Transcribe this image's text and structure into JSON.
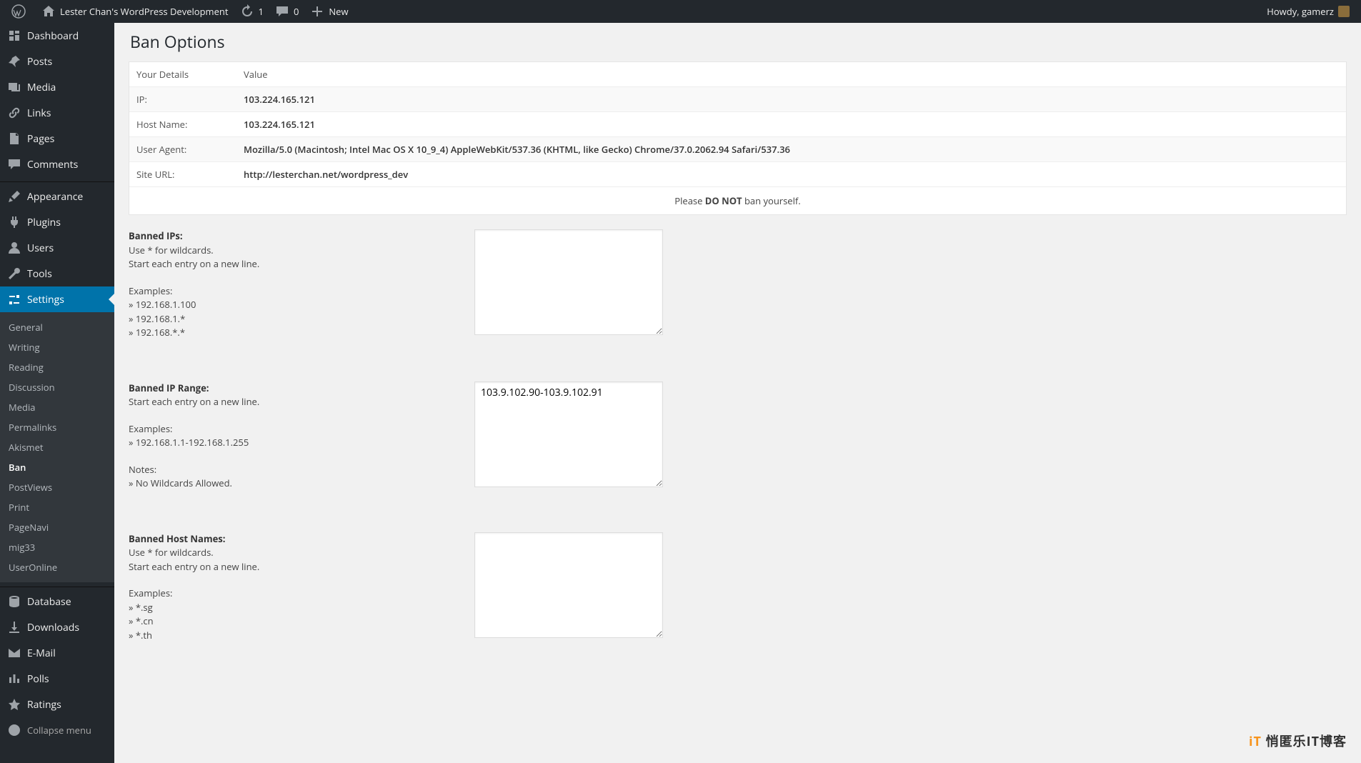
{
  "adminbar": {
    "site_name": "Lester Chan's WordPress Development",
    "updates": "1",
    "comments": "0",
    "new": "New",
    "howdy": "Howdy, gamerz"
  },
  "sidebar": {
    "items": [
      {
        "id": "dashboard",
        "label": "Dashboard",
        "icon": "dashboard"
      },
      {
        "id": "posts",
        "label": "Posts",
        "icon": "pin"
      },
      {
        "id": "media",
        "label": "Media",
        "icon": "media"
      },
      {
        "id": "links",
        "label": "Links",
        "icon": "link"
      },
      {
        "id": "pages",
        "label": "Pages",
        "icon": "pages"
      },
      {
        "id": "comments",
        "label": "Comments",
        "icon": "comment"
      },
      {
        "id": "appearance",
        "label": "Appearance",
        "icon": "brush"
      },
      {
        "id": "plugins",
        "label": "Plugins",
        "icon": "plug"
      },
      {
        "id": "users",
        "label": "Users",
        "icon": "user"
      },
      {
        "id": "tools",
        "label": "Tools",
        "icon": "wrench"
      },
      {
        "id": "settings",
        "label": "Settings",
        "icon": "sliders"
      },
      {
        "id": "database",
        "label": "Database",
        "icon": "db"
      },
      {
        "id": "downloads",
        "label": "Downloads",
        "icon": "download"
      },
      {
        "id": "email",
        "label": "E-Mail",
        "icon": "mail"
      },
      {
        "id": "polls",
        "label": "Polls",
        "icon": "bars"
      },
      {
        "id": "ratings",
        "label": "Ratings",
        "icon": "star"
      }
    ],
    "settings_submenu": [
      "General",
      "Writing",
      "Reading",
      "Discussion",
      "Media",
      "Permalinks",
      "Akismet",
      "Ban",
      "PostViews",
      "Print",
      "PageNavi",
      "mig33",
      "UserOnline"
    ],
    "collapse": "Collapse menu"
  },
  "page": {
    "title": "Ban Options",
    "details_header": {
      "col1": "Your Details",
      "col2": "Value"
    },
    "details": [
      {
        "label": "IP:",
        "value": "103.224.165.121"
      },
      {
        "label": "Host Name:",
        "value": "103.224.165.121"
      },
      {
        "label": "User Agent:",
        "value": "Mozilla/5.0 (Macintosh; Intel Mac OS X 10_9_4) AppleWebKit/537.36 (KHTML, like Gecko) Chrome/37.0.2062.94 Safari/537.36"
      },
      {
        "label": "Site URL:",
        "value": "http://lesterchan.net/wordpress_dev"
      }
    ],
    "warning_prefix": "Please ",
    "warning_strong": "DO NOT",
    "warning_suffix": " ban yourself.",
    "sections": [
      {
        "title": "Banned IPs:",
        "hints": [
          "Use * for wildcards.",
          "Start each entry on a new line."
        ],
        "examples_label": "Examples:",
        "examples": [
          "» 192.168.1.100",
          "» 192.168.1.*",
          "» 192.168.*.*"
        ],
        "value": ""
      },
      {
        "title": "Banned IP Range:",
        "hints": [
          "Start each entry on a new line."
        ],
        "examples_label": "Examples:",
        "examples": [
          "» 192.168.1.1-192.168.1.255"
        ],
        "notes_label": "Notes:",
        "notes": [
          "» No Wildcards Allowed."
        ],
        "value": "103.9.102.90-103.9.102.91"
      },
      {
        "title": "Banned Host Names:",
        "hints": [
          "Use * for wildcards.",
          "Start each entry on a new line."
        ],
        "examples_label": "Examples:",
        "examples": [
          "» *.sg",
          "» *.cn",
          "» *.th"
        ],
        "value": ""
      }
    ]
  },
  "watermark": "悄匿乐IT博客"
}
